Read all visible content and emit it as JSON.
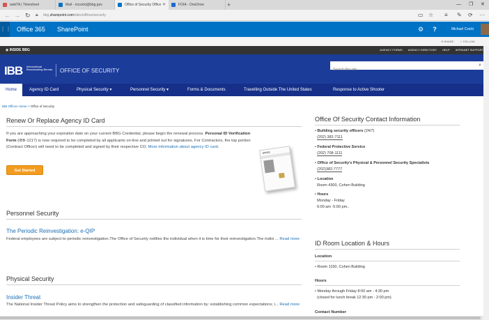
{
  "browser": {
    "tabs": [
      {
        "label": "webTA | Timesheet",
        "fav": "#d9534f",
        "active": false
      },
      {
        "label": "Mail - mcsicki@bbg.gov",
        "fav": "#0072c6",
        "active": false
      },
      {
        "label": "Office of Security Office",
        "fav": "#0072c6",
        "active": true
      },
      {
        "label": "FOIA - OneDrive",
        "fav": "#1e6bcd",
        "active": false
      }
    ],
    "new_tab": "+",
    "url_prefix": "bbg.",
    "url_domain": "sharepoint.com",
    "url_path": "/sites/offices/security"
  },
  "suite": {
    "app_name": "Office 365",
    "product": "SharePoint",
    "user": "Michael Csicki"
  },
  "actions": {
    "share": "SHARE",
    "follow": "FOLLOW"
  },
  "inside": {
    "label": "INSIDE BBG",
    "links": [
      "AGENCY FORMS",
      "AGENCY DIRECTORY",
      "HELP",
      "INTRANET SUPPORT"
    ]
  },
  "banner": {
    "logo": "IBB",
    "logo_sub": "International Broadcasting Bureau",
    "office_name": "OFFICE OF SECURITY",
    "search_placeholder": "Search this site"
  },
  "nav": {
    "items": [
      "Home",
      "Agency ID Card",
      "Physical Security ▾",
      "Personnel Security ▾",
      "Forms & Documents",
      "Travelling Outside The United States",
      "Response to Active Shooter"
    ]
  },
  "breadcrumb": {
    "parent": "IBB Offices Home",
    "sep": " > ",
    "current": "Office of Security"
  },
  "renew": {
    "title": "Renew Or Replace Agency ID Card",
    "text1": "If you are approaching your expiration date on your current BBG Credential, please begin the renewal process. ",
    "bold": "Personal ID Verification Form",
    "text2": " (IBB-1217) is now required to be completed by all applicants on-line and printed out for signatures. For Contractors, the top portion (Contract Officer) will need to be completed and signed by their respective CO. ",
    "more": "More information about agency ID card",
    "dot": ".",
    "button": "Get Started"
  },
  "personnel": {
    "title": "Personnel Security",
    "sub": "The Periodic Reinvestigation: e-QIP",
    "text": "Federal employees are subject to periodic reinvestigation.The Office of Security notifies the individual when it is time for their reinvestigation.The indivi ... ",
    "more": "Read more"
  },
  "physical": {
    "title": "Physical Security",
    "sub": "Insider Threat",
    "text": "The National Insider Threat Policy aims to strengthen the protection and safeguarding of classified information by: establishing common expectations; i... ",
    "more": "Read more"
  },
  "contact": {
    "title": "Office Of Security Contact Information",
    "items": [
      {
        "label": "Building security officers",
        "suffix": " (24/7)",
        "phone": "(202) 382-7111"
      },
      {
        "label": "Federal Protective Service",
        "suffix": "",
        "phone": "(202) 708-1111"
      },
      {
        "label": "Office of Security's Physical & Personnel Security Specialists",
        "suffix": "",
        "phone": "(202)382-7777"
      }
    ],
    "location_label": "Location",
    "location": "Room 4300, Cohen Building",
    "hours_label": "Hours",
    "hours_days": "Monday - Friday",
    "hours_time": "6:00 am -5:00 pm.."
  },
  "idroom": {
    "title": "ID Room Location & Hours",
    "location_label": "Location",
    "location": "Room 1150, Cohen Building",
    "hours_label": "Hours",
    "hours_line1": "Monday through Friday 8:00 am - 4:30 pm",
    "hours_line2": "(closed for lunch break 12:30 pm - 2:00 pm)",
    "contact_label": "Contact Number"
  },
  "idcard_graphic": {
    "title": "OFFICE"
  }
}
